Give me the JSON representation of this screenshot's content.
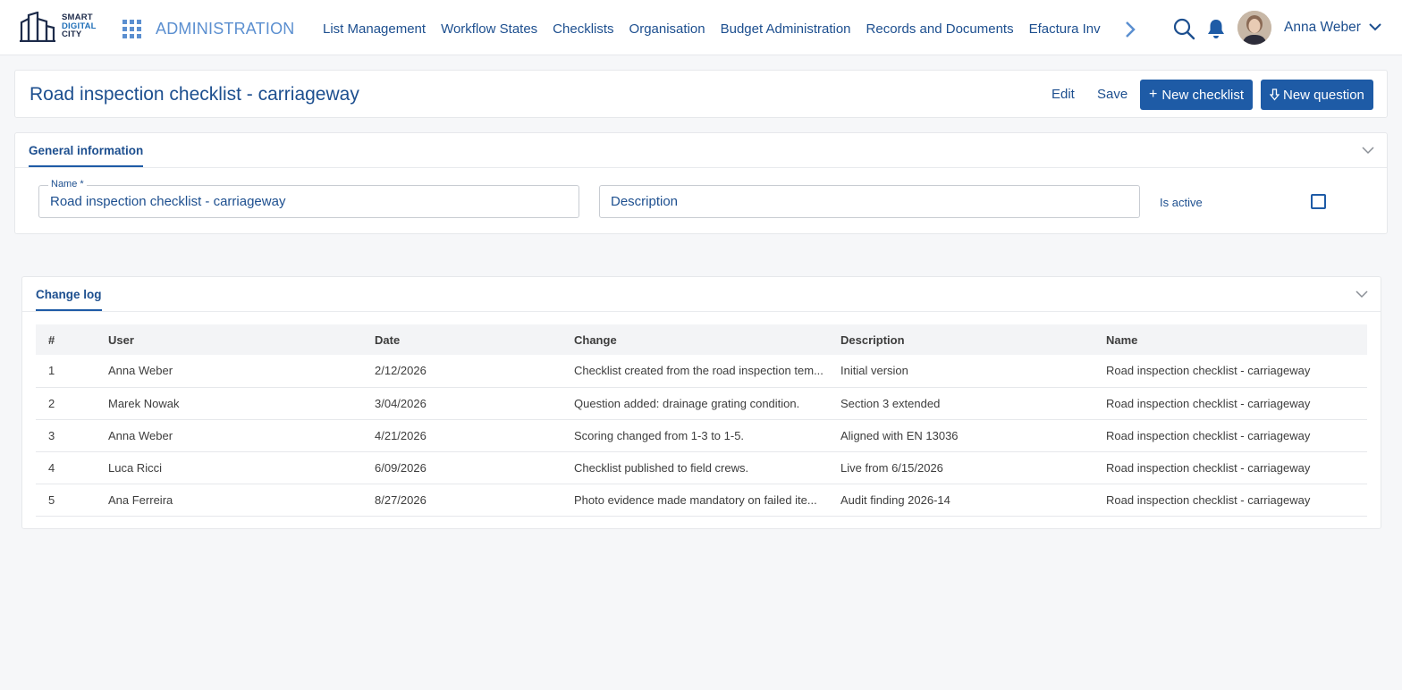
{
  "brand": {
    "line1": "SMART",
    "line2": "DIGITAL",
    "line3": "CITY"
  },
  "header": {
    "module": "ADMINISTRATION",
    "nav": [
      "List Management",
      "Workflow States",
      "Checklists",
      "Organisation",
      "Budget Administration",
      "Records and Documents",
      "Efactura Inv"
    ],
    "user": "Anna Weber"
  },
  "page": {
    "title": "Road inspection checklist - carriageway",
    "actions": {
      "edit": "Edit",
      "save": "Save",
      "new_checklist": "New checklist",
      "new_question": "New question"
    }
  },
  "general": {
    "tab": "General information",
    "name_label": "Name *",
    "name_value": "Road inspection checklist - carriageway",
    "description_placeholder": "Description",
    "active_label": "Is active",
    "active": false
  },
  "changelog": {
    "tab": "Change log",
    "columns": [
      "#",
      "User",
      "Date",
      "Change",
      "Description",
      "Name"
    ],
    "rows": [
      [
        "1",
        "Anna Weber",
        "2/12/2026",
        "Checklist created from the road inspection tem...",
        "Initial version",
        "Road inspection checklist - carriageway"
      ],
      [
        "2",
        "Marek Nowak",
        "3/04/2026",
        "Question added: drainage grating condition.",
        "Section 3 extended",
        "Road inspection checklist - carriageway"
      ],
      [
        "3",
        "Anna Weber",
        "4/21/2026",
        "Scoring changed from 1-3 to 1-5.",
        "Aligned with EN 13036",
        "Road inspection checklist - carriageway"
      ],
      [
        "4",
        "Luca Ricci",
        "6/09/2026",
        "Checklist published to field crews.",
        "Live from 6/15/2026",
        "Road inspection checklist - carriageway"
      ],
      [
        "5",
        "Ana Ferreira",
        "8/27/2026",
        "Photo evidence made mandatory on failed ite...",
        "Audit finding 2026-14",
        "Road inspection checklist - carriageway"
      ]
    ]
  },
  "colors": {
    "primary": "#1e5ba6",
    "text_primary": "#1d4f8f",
    "accent_light": "#5b8fd0"
  }
}
